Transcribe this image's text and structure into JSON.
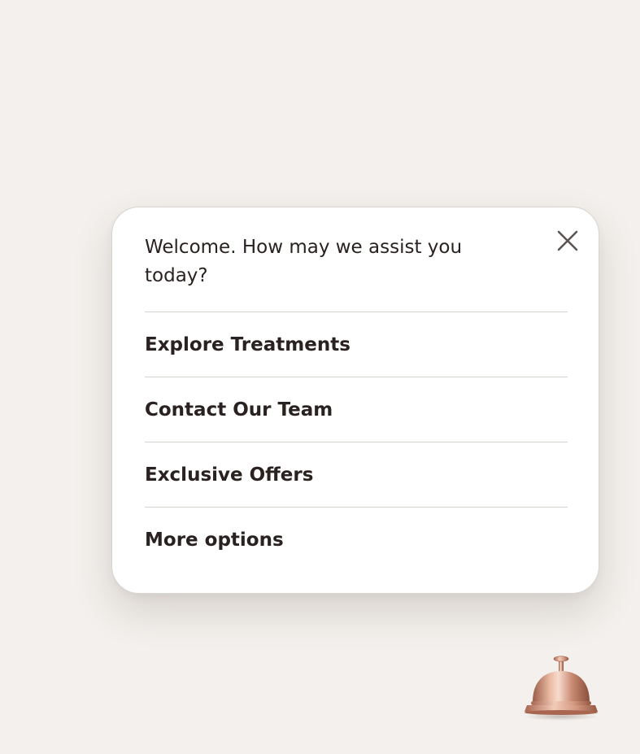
{
  "popup": {
    "greeting": "Welcome. How may we assist you today?",
    "close_icon": "close-icon",
    "menu": [
      {
        "id": "explore-treatments",
        "label": "Explore Treatments"
      },
      {
        "id": "contact-our-team",
        "label": "Contact Our Team"
      },
      {
        "id": "exclusive-offers",
        "label": "Exclusive Offers"
      },
      {
        "id": "more-options",
        "label": "More options"
      }
    ]
  },
  "launcher": {
    "icon": "service-bell-icon"
  },
  "colors": {
    "background": "#f3f0ed",
    "panel": "#ffffff",
    "text": "#2a2220",
    "divider": "#d6d2ce",
    "bell_copper": "#c8907a"
  }
}
